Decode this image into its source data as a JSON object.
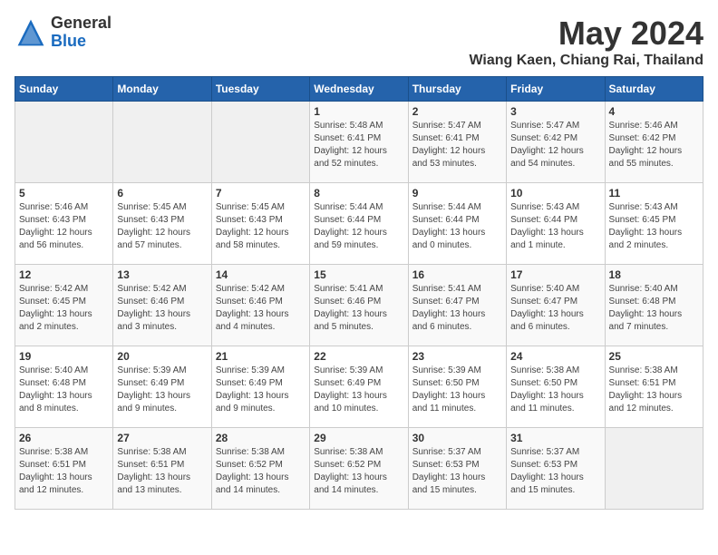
{
  "logo": {
    "general": "General",
    "blue": "Blue"
  },
  "title": "May 2024",
  "subtitle": "Wiang Kaen, Chiang Rai, Thailand",
  "days": [
    "Sunday",
    "Monday",
    "Tuesday",
    "Wednesday",
    "Thursday",
    "Friday",
    "Saturday"
  ],
  "weeks": [
    [
      {
        "day": "",
        "content": ""
      },
      {
        "day": "",
        "content": ""
      },
      {
        "day": "",
        "content": ""
      },
      {
        "day": "1",
        "content": "Sunrise: 5:48 AM\nSunset: 6:41 PM\nDaylight: 12 hours\nand 52 minutes."
      },
      {
        "day": "2",
        "content": "Sunrise: 5:47 AM\nSunset: 6:41 PM\nDaylight: 12 hours\nand 53 minutes."
      },
      {
        "day": "3",
        "content": "Sunrise: 5:47 AM\nSunset: 6:42 PM\nDaylight: 12 hours\nand 54 minutes."
      },
      {
        "day": "4",
        "content": "Sunrise: 5:46 AM\nSunset: 6:42 PM\nDaylight: 12 hours\nand 55 minutes."
      }
    ],
    [
      {
        "day": "5",
        "content": "Sunrise: 5:46 AM\nSunset: 6:43 PM\nDaylight: 12 hours\nand 56 minutes."
      },
      {
        "day": "6",
        "content": "Sunrise: 5:45 AM\nSunset: 6:43 PM\nDaylight: 12 hours\nand 57 minutes."
      },
      {
        "day": "7",
        "content": "Sunrise: 5:45 AM\nSunset: 6:43 PM\nDaylight: 12 hours\nand 58 minutes."
      },
      {
        "day": "8",
        "content": "Sunrise: 5:44 AM\nSunset: 6:44 PM\nDaylight: 12 hours\nand 59 minutes."
      },
      {
        "day": "9",
        "content": "Sunrise: 5:44 AM\nSunset: 6:44 PM\nDaylight: 13 hours\nand 0 minutes."
      },
      {
        "day": "10",
        "content": "Sunrise: 5:43 AM\nSunset: 6:44 PM\nDaylight: 13 hours\nand 1 minute."
      },
      {
        "day": "11",
        "content": "Sunrise: 5:43 AM\nSunset: 6:45 PM\nDaylight: 13 hours\nand 2 minutes."
      }
    ],
    [
      {
        "day": "12",
        "content": "Sunrise: 5:42 AM\nSunset: 6:45 PM\nDaylight: 13 hours\nand 2 minutes."
      },
      {
        "day": "13",
        "content": "Sunrise: 5:42 AM\nSunset: 6:46 PM\nDaylight: 13 hours\nand 3 minutes."
      },
      {
        "day": "14",
        "content": "Sunrise: 5:42 AM\nSunset: 6:46 PM\nDaylight: 13 hours\nand 4 minutes."
      },
      {
        "day": "15",
        "content": "Sunrise: 5:41 AM\nSunset: 6:46 PM\nDaylight: 13 hours\nand 5 minutes."
      },
      {
        "day": "16",
        "content": "Sunrise: 5:41 AM\nSunset: 6:47 PM\nDaylight: 13 hours\nand 6 minutes."
      },
      {
        "day": "17",
        "content": "Sunrise: 5:40 AM\nSunset: 6:47 PM\nDaylight: 13 hours\nand 6 minutes."
      },
      {
        "day": "18",
        "content": "Sunrise: 5:40 AM\nSunset: 6:48 PM\nDaylight: 13 hours\nand 7 minutes."
      }
    ],
    [
      {
        "day": "19",
        "content": "Sunrise: 5:40 AM\nSunset: 6:48 PM\nDaylight: 13 hours\nand 8 minutes."
      },
      {
        "day": "20",
        "content": "Sunrise: 5:39 AM\nSunset: 6:49 PM\nDaylight: 13 hours\nand 9 minutes."
      },
      {
        "day": "21",
        "content": "Sunrise: 5:39 AM\nSunset: 6:49 PM\nDaylight: 13 hours\nand 9 minutes."
      },
      {
        "day": "22",
        "content": "Sunrise: 5:39 AM\nSunset: 6:49 PM\nDaylight: 13 hours\nand 10 minutes."
      },
      {
        "day": "23",
        "content": "Sunrise: 5:39 AM\nSunset: 6:50 PM\nDaylight: 13 hours\nand 11 minutes."
      },
      {
        "day": "24",
        "content": "Sunrise: 5:38 AM\nSunset: 6:50 PM\nDaylight: 13 hours\nand 11 minutes."
      },
      {
        "day": "25",
        "content": "Sunrise: 5:38 AM\nSunset: 6:51 PM\nDaylight: 13 hours\nand 12 minutes."
      }
    ],
    [
      {
        "day": "26",
        "content": "Sunrise: 5:38 AM\nSunset: 6:51 PM\nDaylight: 13 hours\nand 12 minutes."
      },
      {
        "day": "27",
        "content": "Sunrise: 5:38 AM\nSunset: 6:51 PM\nDaylight: 13 hours\nand 13 minutes."
      },
      {
        "day": "28",
        "content": "Sunrise: 5:38 AM\nSunset: 6:52 PM\nDaylight: 13 hours\nand 14 minutes."
      },
      {
        "day": "29",
        "content": "Sunrise: 5:38 AM\nSunset: 6:52 PM\nDaylight: 13 hours\nand 14 minutes."
      },
      {
        "day": "30",
        "content": "Sunrise: 5:37 AM\nSunset: 6:53 PM\nDaylight: 13 hours\nand 15 minutes."
      },
      {
        "day": "31",
        "content": "Sunrise: 5:37 AM\nSunset: 6:53 PM\nDaylight: 13 hours\nand 15 minutes."
      },
      {
        "day": "",
        "content": ""
      }
    ]
  ]
}
